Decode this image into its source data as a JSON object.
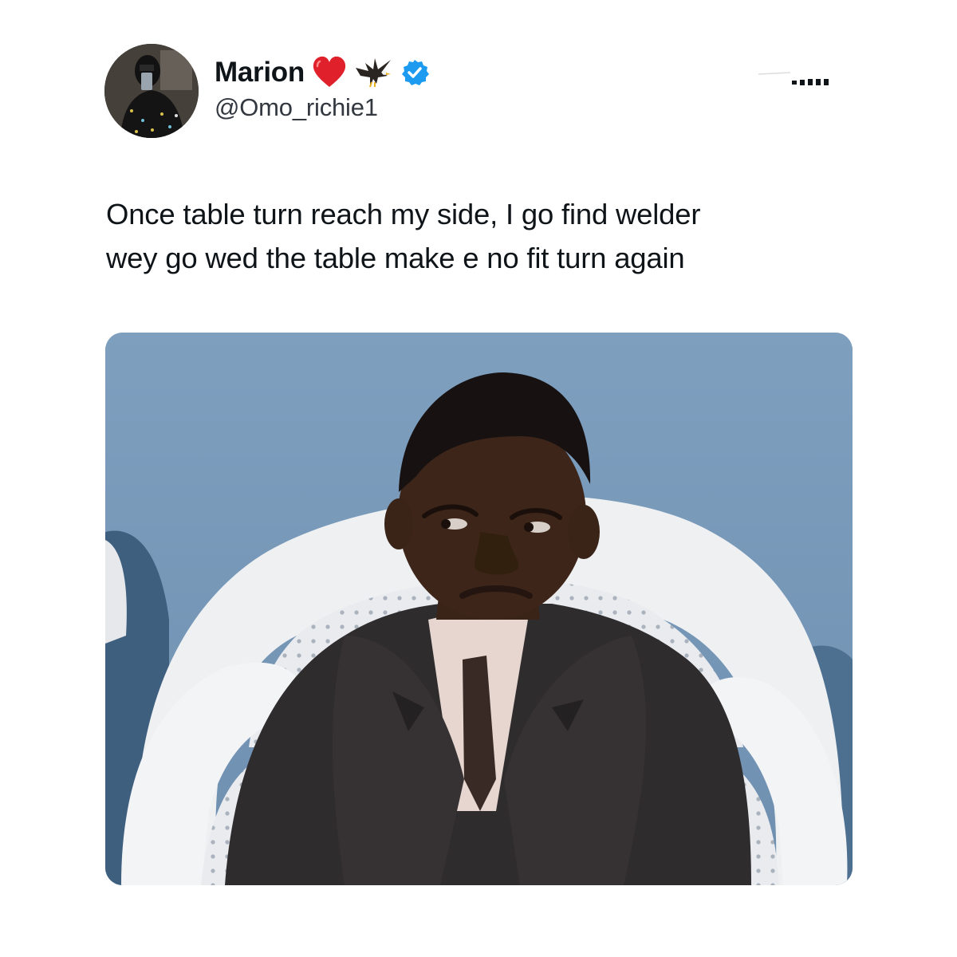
{
  "tweet": {
    "display_name": "Marion",
    "handle": "@Omo_richie1",
    "name_emojis": [
      "heart-emoji",
      "eagle-emoji"
    ],
    "verified": true,
    "text_lines": [
      "Once table turn reach my side, I go find welder",
      "wey go wed the table make e no fit turn again"
    ]
  },
  "colors": {
    "verified_badge": "#1d9bf0",
    "heart": "#e0202a",
    "text": "#0f1419",
    "handle": "#333840",
    "photo_wall": "#7e9dbc",
    "chair": "#eceef0",
    "suit": "#2f2c2e"
  },
  "icons": {
    "verified": "verified-badge-icon",
    "more": "more-options-icon"
  }
}
